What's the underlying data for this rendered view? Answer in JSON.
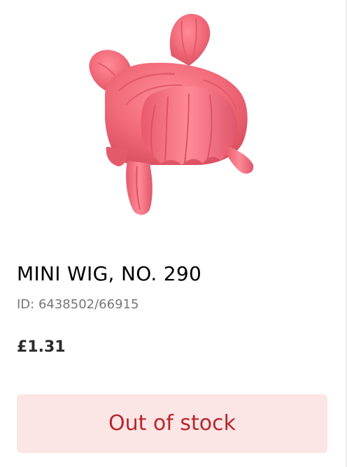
{
  "product": {
    "name": "MINI WIG, NO. 290",
    "id_text": "ID: 6438502/66915",
    "price": "£1.31",
    "stock_status": "Out of stock"
  },
  "colors": {
    "wig_pink": "#f26b7a",
    "stock_button_bg": "#fce5e5",
    "stock_button_text": "#b8262c",
    "id_text": "#767676"
  }
}
